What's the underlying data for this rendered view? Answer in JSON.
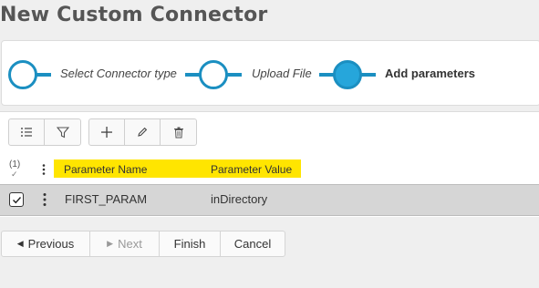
{
  "page": {
    "title": "New Custom Connector"
  },
  "wizard": {
    "steps": [
      {
        "label": "Select Connector type",
        "state": "completed"
      },
      {
        "label": "Upload File",
        "state": "completed"
      },
      {
        "label": "Add parameters",
        "state": "active"
      }
    ],
    "accent_color": "#1b8fc1",
    "active_fill": "#26a6db"
  },
  "toolbar": {
    "icons": [
      "list-icon",
      "filter-icon",
      "plus-icon",
      "pencil-icon",
      "trash-icon"
    ]
  },
  "grid": {
    "selection_count": "(1)",
    "header_highlight_color": "#ffe500",
    "columns": [
      "Parameter Name",
      "Parameter Value"
    ],
    "rows": [
      {
        "name": "FIRST_PARAM",
        "value": "inDirectory",
        "checked": true
      }
    ]
  },
  "footer": {
    "previous_label": "Previous",
    "next_label": "Next",
    "finish_label": "Finish",
    "cancel_label": "Cancel"
  }
}
